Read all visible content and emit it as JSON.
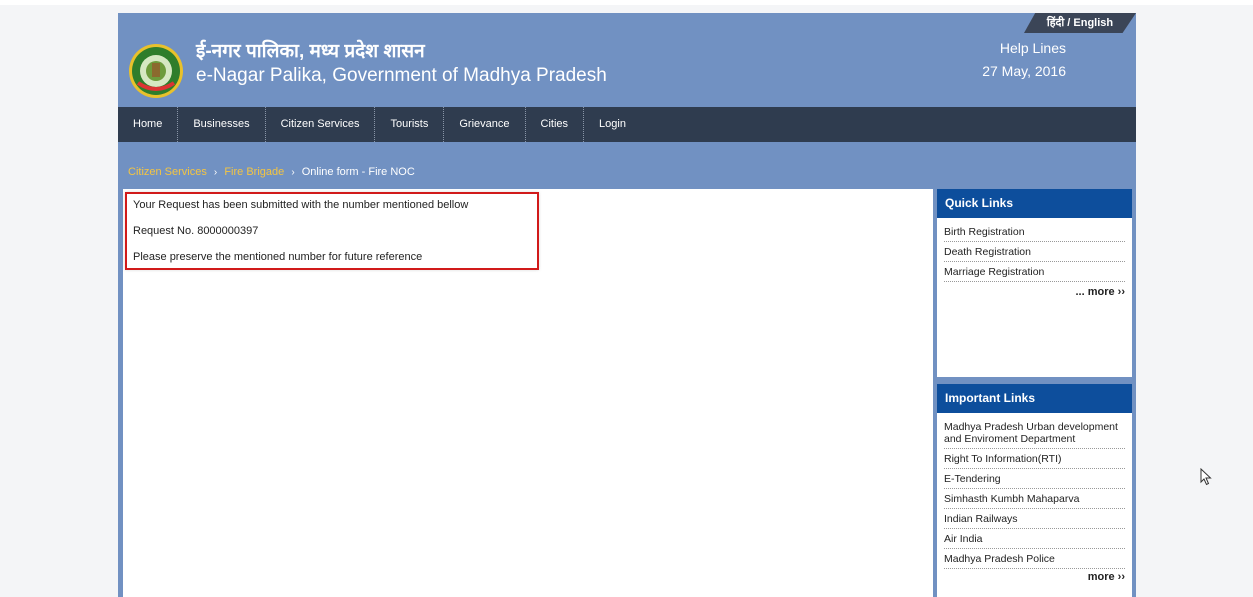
{
  "header": {
    "lang_toggle": "हिंदी / English",
    "title_hindi": "ई-नगर पालिका, मध्य प्रदेश शासन",
    "title_english": "e-Nagar Palika, Government of Madhya Pradesh",
    "help_lines": "Help Lines",
    "date": "27 May, 2016"
  },
  "nav": {
    "items": [
      "Home",
      "Businesses",
      "Citizen Services",
      "Tourists",
      "Grievance",
      "Cities",
      "Login"
    ]
  },
  "breadcrumb": {
    "crumb1": "Citizen Services",
    "crumb2": "Fire Brigade",
    "current": "Online form - Fire NOC",
    "separator": "›"
  },
  "message": {
    "line1": "Your Request has been submitted with the number mentioned bellow",
    "line2": "Request No. 8000000397",
    "line3": "Please preserve the mentioned number for future reference"
  },
  "quick_links": {
    "title": "Quick Links",
    "items": [
      "Birth Registration",
      "Death Registration",
      "Marriage Registration"
    ],
    "more": "... more ››"
  },
  "important_links": {
    "title": "Important Links",
    "items": [
      "Madhya Pradesh Urban development and Enviroment Department",
      "Right To Information(RTI)",
      "E-Tendering",
      "Simhasth Kumbh Mahaparva",
      "Indian Railways",
      "Air India",
      "Madhya Pradesh Police"
    ],
    "more": "more ››"
  },
  "colors": {
    "header_bg": "#7191c2",
    "nav_bg": "#2f3c4f",
    "panel_head_bg": "#0d4e9c",
    "breadcrumb_link": "#f4c542",
    "highlight_border": "#d11a1a"
  }
}
